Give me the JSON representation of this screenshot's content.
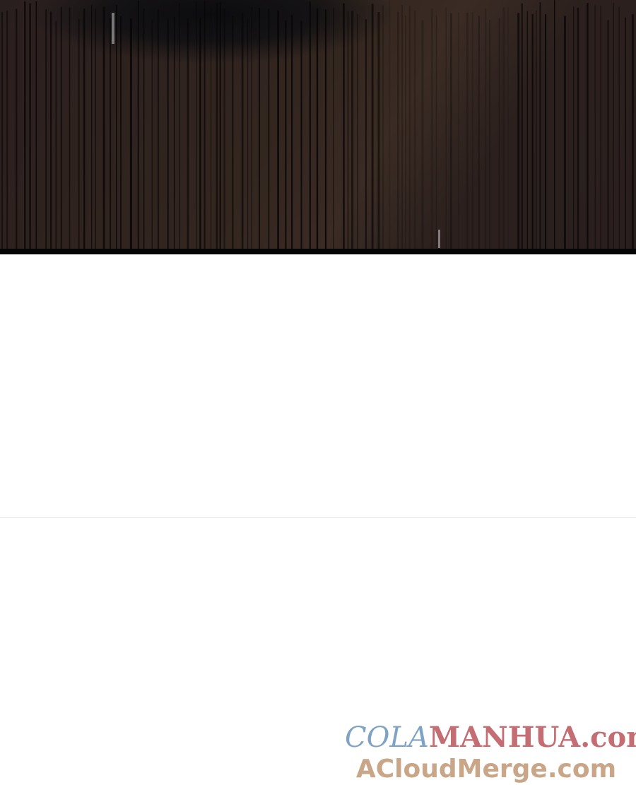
{
  "page": {
    "background": "#ffffff"
  },
  "panel": {
    "image_description_icon": "dark-curtain-illustration",
    "border_color": "#050505"
  },
  "watermark": {
    "line1_part1": "COLA",
    "line1_part2": "MANHUA",
    "line1_part3": ".com",
    "line2": "ACloudMerge.com",
    "colors": {
      "cola": "#7fa3c4",
      "manhua": "#c46d73",
      "acloudmerge": "#c8a687"
    }
  }
}
